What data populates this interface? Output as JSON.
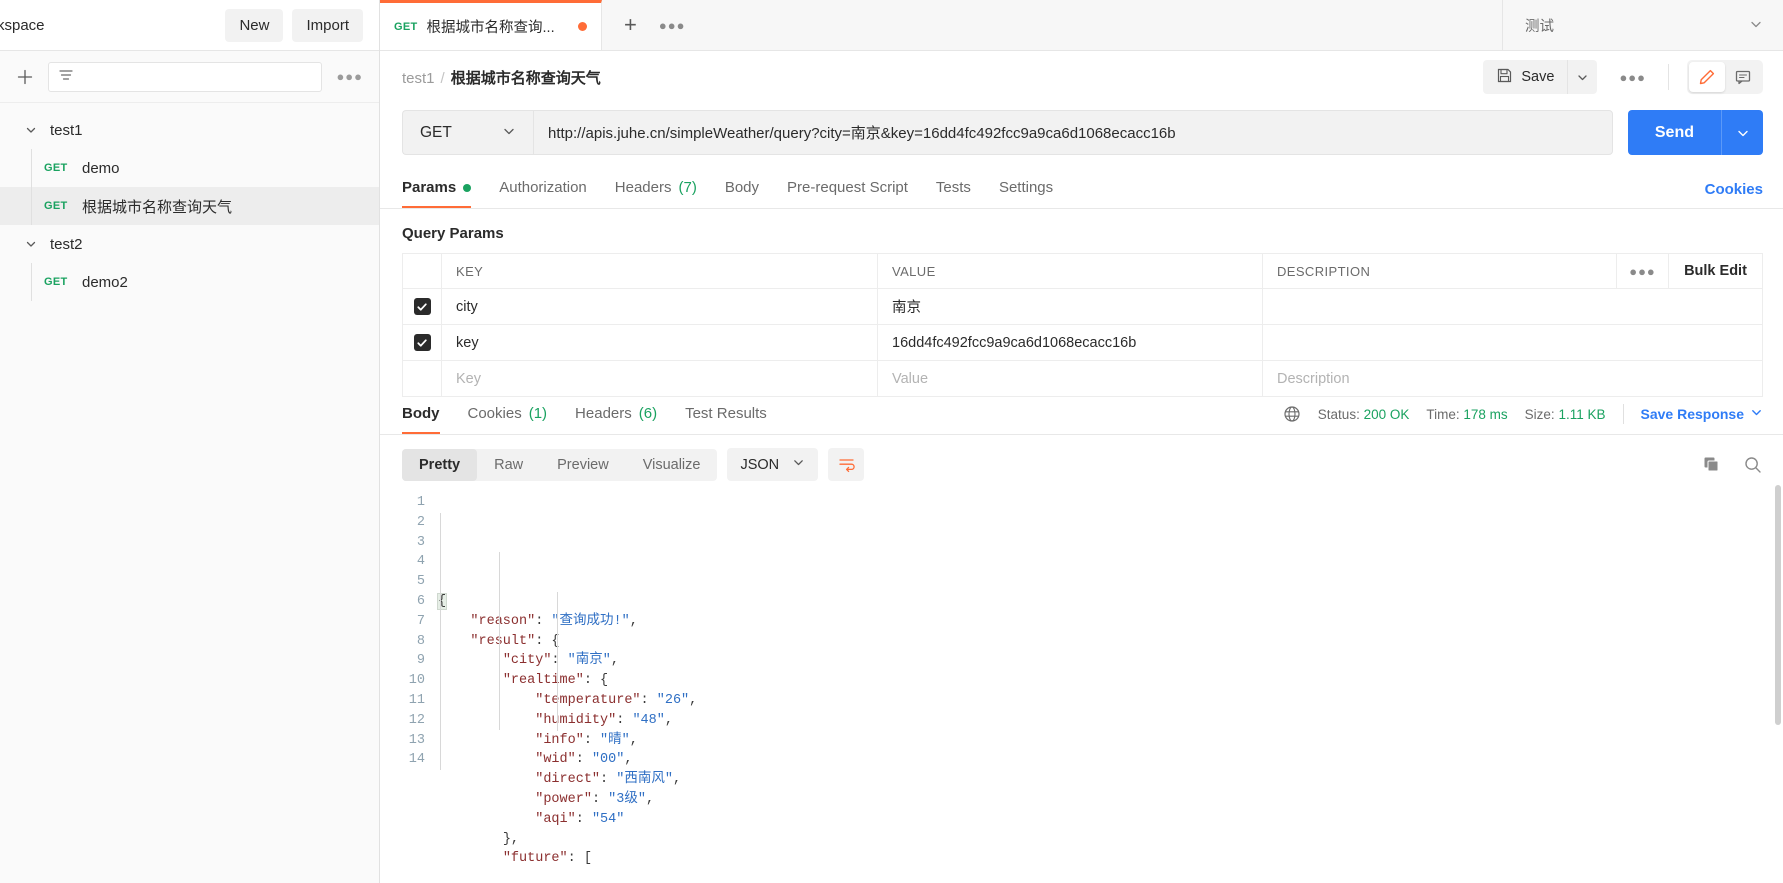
{
  "sidebar": {
    "workspace_title": "rkspace",
    "new_label": "New",
    "import_label": "Import",
    "filter_placeholder": "",
    "tree": [
      {
        "type": "folder",
        "name": "test1",
        "expanded": true
      },
      {
        "type": "request",
        "method": "GET",
        "name": "demo",
        "active": false
      },
      {
        "type": "request",
        "method": "GET",
        "name": "根据城市名称查询天气",
        "active": true
      },
      {
        "type": "folder",
        "name": "test2",
        "expanded": true
      },
      {
        "type": "request",
        "method": "GET",
        "name": "demo2",
        "active": false
      }
    ]
  },
  "tabbar": {
    "tab_method": "GET",
    "tab_label": "根据城市名称查询...",
    "environment": "测试"
  },
  "header": {
    "breadcrumb_parent": "test1",
    "breadcrumb_sep": "/",
    "breadcrumb_current": "根据城市名称查询天气",
    "save_label": "Save"
  },
  "request": {
    "method": "GET",
    "url": "http://apis.juhe.cn/simpleWeather/query?city=南京&key=16dd4fc492fcc9a9ca6d1068ecacc16b",
    "send_label": "Send",
    "tabs": [
      {
        "label": "Params",
        "dot": true,
        "active": true
      },
      {
        "label": "Authorization",
        "active": false
      },
      {
        "label": "Headers",
        "count": "(7)",
        "active": false
      },
      {
        "label": "Body",
        "active": false
      },
      {
        "label": "Pre-request Script",
        "active": false
      },
      {
        "label": "Tests",
        "active": false
      },
      {
        "label": "Settings",
        "active": false
      }
    ],
    "cookies_link": "Cookies"
  },
  "params": {
    "section_title": "Query Params",
    "columns": {
      "key": "KEY",
      "value": "VALUE",
      "description": "DESCRIPTION"
    },
    "bulk_edit_label": "Bulk Edit",
    "rows": [
      {
        "checked": true,
        "key": "city",
        "value": "南京",
        "description": ""
      },
      {
        "checked": true,
        "key": "key",
        "value": "16dd4fc492fcc9a9ca6d1068ecacc16b",
        "description": ""
      }
    ],
    "placeholder_row": {
      "key": "Key",
      "value": "Value",
      "description": "Description"
    }
  },
  "response": {
    "tabs": [
      {
        "label": "Body",
        "active": true
      },
      {
        "label": "Cookies",
        "count": "(1)",
        "active": false
      },
      {
        "label": "Headers",
        "count": "(6)",
        "active": false
      },
      {
        "label": "Test Results",
        "active": false
      }
    ],
    "status_label": "Status:",
    "status_value": "200 OK",
    "time_label": "Time:",
    "time_value": "178 ms",
    "size_label": "Size:",
    "size_value": "1.11 KB",
    "save_response_label": "Save Response",
    "view_modes": [
      {
        "label": "Pretty",
        "active": true
      },
      {
        "label": "Raw",
        "active": false
      },
      {
        "label": "Preview",
        "active": false
      },
      {
        "label": "Visualize",
        "active": false
      }
    ],
    "format": "JSON",
    "body_lines": [
      {
        "n": "1",
        "indent": 0,
        "tokens": [
          [
            "p",
            "{"
          ]
        ]
      },
      {
        "n": "2",
        "indent": 1,
        "tokens": [
          [
            "k",
            "\"reason\""
          ],
          [
            "p",
            ": "
          ],
          [
            "s",
            "\"查询成功!\""
          ],
          [
            "p",
            ","
          ]
        ]
      },
      {
        "n": "3",
        "indent": 1,
        "tokens": [
          [
            "k",
            "\"result\""
          ],
          [
            "p",
            ": {"
          ]
        ]
      },
      {
        "n": "4",
        "indent": 2,
        "tokens": [
          [
            "k",
            "\"city\""
          ],
          [
            "p",
            ": "
          ],
          [
            "s",
            "\"南京\""
          ],
          [
            "p",
            ","
          ]
        ]
      },
      {
        "n": "5",
        "indent": 2,
        "tokens": [
          [
            "k",
            "\"realtime\""
          ],
          [
            "p",
            ": {"
          ]
        ]
      },
      {
        "n": "6",
        "indent": 3,
        "tokens": [
          [
            "k",
            "\"temperature\""
          ],
          [
            "p",
            ": "
          ],
          [
            "s",
            "\"26\""
          ],
          [
            "p",
            ","
          ]
        ]
      },
      {
        "n": "7",
        "indent": 3,
        "tokens": [
          [
            "k",
            "\"humidity\""
          ],
          [
            "p",
            ": "
          ],
          [
            "s",
            "\"48\""
          ],
          [
            "p",
            ","
          ]
        ]
      },
      {
        "n": "8",
        "indent": 3,
        "tokens": [
          [
            "k",
            "\"info\""
          ],
          [
            "p",
            ": "
          ],
          [
            "s",
            "\"晴\""
          ],
          [
            "p",
            ","
          ]
        ]
      },
      {
        "n": "9",
        "indent": 3,
        "tokens": [
          [
            "k",
            "\"wid\""
          ],
          [
            "p",
            ": "
          ],
          [
            "s",
            "\"00\""
          ],
          [
            "p",
            ","
          ]
        ]
      },
      {
        "n": "10",
        "indent": 3,
        "tokens": [
          [
            "k",
            "\"direct\""
          ],
          [
            "p",
            ": "
          ],
          [
            "s",
            "\"西南风\""
          ],
          [
            "p",
            ","
          ]
        ]
      },
      {
        "n": "11",
        "indent": 3,
        "tokens": [
          [
            "k",
            "\"power\""
          ],
          [
            "p",
            ": "
          ],
          [
            "s",
            "\"3级\""
          ],
          [
            "p",
            ","
          ]
        ]
      },
      {
        "n": "12",
        "indent": 3,
        "tokens": [
          [
            "k",
            "\"aqi\""
          ],
          [
            "p",
            ": "
          ],
          [
            "s",
            "\"54\""
          ]
        ]
      },
      {
        "n": "13",
        "indent": 2,
        "tokens": [
          [
            "p",
            "},"
          ]
        ]
      },
      {
        "n": "14",
        "indent": 2,
        "tokens": [
          [
            "k",
            "\"future\""
          ],
          [
            "p",
            ": ["
          ]
        ]
      }
    ]
  }
}
